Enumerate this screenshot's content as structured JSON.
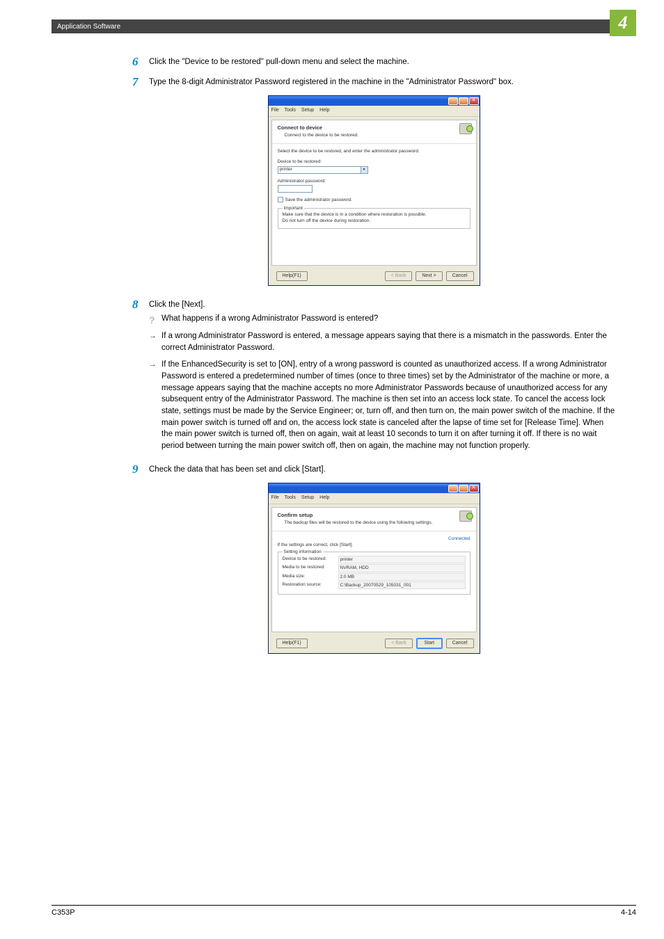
{
  "header": {
    "section": "Application Software",
    "chapter": "4"
  },
  "footer": {
    "left": "C353P",
    "right": "4-14"
  },
  "steps": {
    "s6": {
      "num": "6",
      "text": "Click the \"Device to be restored\" pull-down menu and select the machine."
    },
    "s7": {
      "num": "7",
      "text": "Type the 8-digit Administrator Password registered in the machine in the \"Administrator Password\" box."
    },
    "s8": {
      "num": "8",
      "text": "Click the [Next].",
      "q": "What happens if a wrong Administrator Password is entered?",
      "a1": "If a wrong Administrator Password is entered, a message appears saying that there is a mismatch in the passwords. Enter the correct Administrator Password.",
      "a2": "If the EnhancedSecurity is set to [ON], entry of a wrong password is counted as unauthorized access. If a wrong Administrator Password is entered a predetermined number of times (once to three times) set by the Administrator of the machine or more, a message appears saying that the machine accepts no more Administrator Passwords because of unauthorized access for any subsequent entry of the Administrator Password. The machine is then set into an access lock state. To cancel the access lock state, settings must be made by the Service Engineer; or, turn off, and then turn on, the main power switch of the machine. If the main power switch is turned off and on, the access lock state is canceled after the lapse of time set for [Release Time]. When the main power switch is turned off, then on again, wait at least 10 seconds to turn it on after turning it off. If there is no wait period between turning the main power switch off, then on again, the machine may not function properly."
    },
    "s9": {
      "num": "9",
      "text": "Check the data that has been set and click [Start]."
    }
  },
  "dialog1": {
    "menu": {
      "file": "File",
      "tools": "Tools",
      "setup": "Setup",
      "help": "Help"
    },
    "title": "Connect to device",
    "subtitle": "Connect to the device to be restored.",
    "instruction": "Select the device to be restored, and enter the administrator password.",
    "device_label": "Device to be restored:",
    "device_value": "printer",
    "pw_label": "Administrator password:",
    "save_label": "Save the administrator password.",
    "important": {
      "legend": "Important",
      "line1": "Make sure that the device is in a condition where restoration is possible.",
      "line2": "Do not turn off the device during restoration."
    },
    "buttons": {
      "help": "Help(F1)",
      "back": "< Back",
      "next": "Next >",
      "cancel": "Cancel"
    }
  },
  "dialog2": {
    "menu": {
      "file": "File",
      "tools": "Tools",
      "setup": "Setup",
      "help": "Help"
    },
    "title": "Confirm setup",
    "subtitle": "The backup files will be restored to the device using the following settings.",
    "connected": "Connected",
    "instruction": "If the settings are correct, click [Start].",
    "legend": "Setting information",
    "rows": {
      "device": {
        "label": "Device to be restored:",
        "value": "printer"
      },
      "media": {
        "label": "Media to be restored:",
        "value": "NVRAM, HDD"
      },
      "size": {
        "label": "Media size:",
        "value": "2.0 MB"
      },
      "source": {
        "label": "Restoration source:",
        "value": "C:\\Backup_20070529_105031_001"
      }
    },
    "buttons": {
      "help": "Help(F1)",
      "back": "< Back",
      "start": "Start",
      "cancel": "Cancel"
    }
  }
}
